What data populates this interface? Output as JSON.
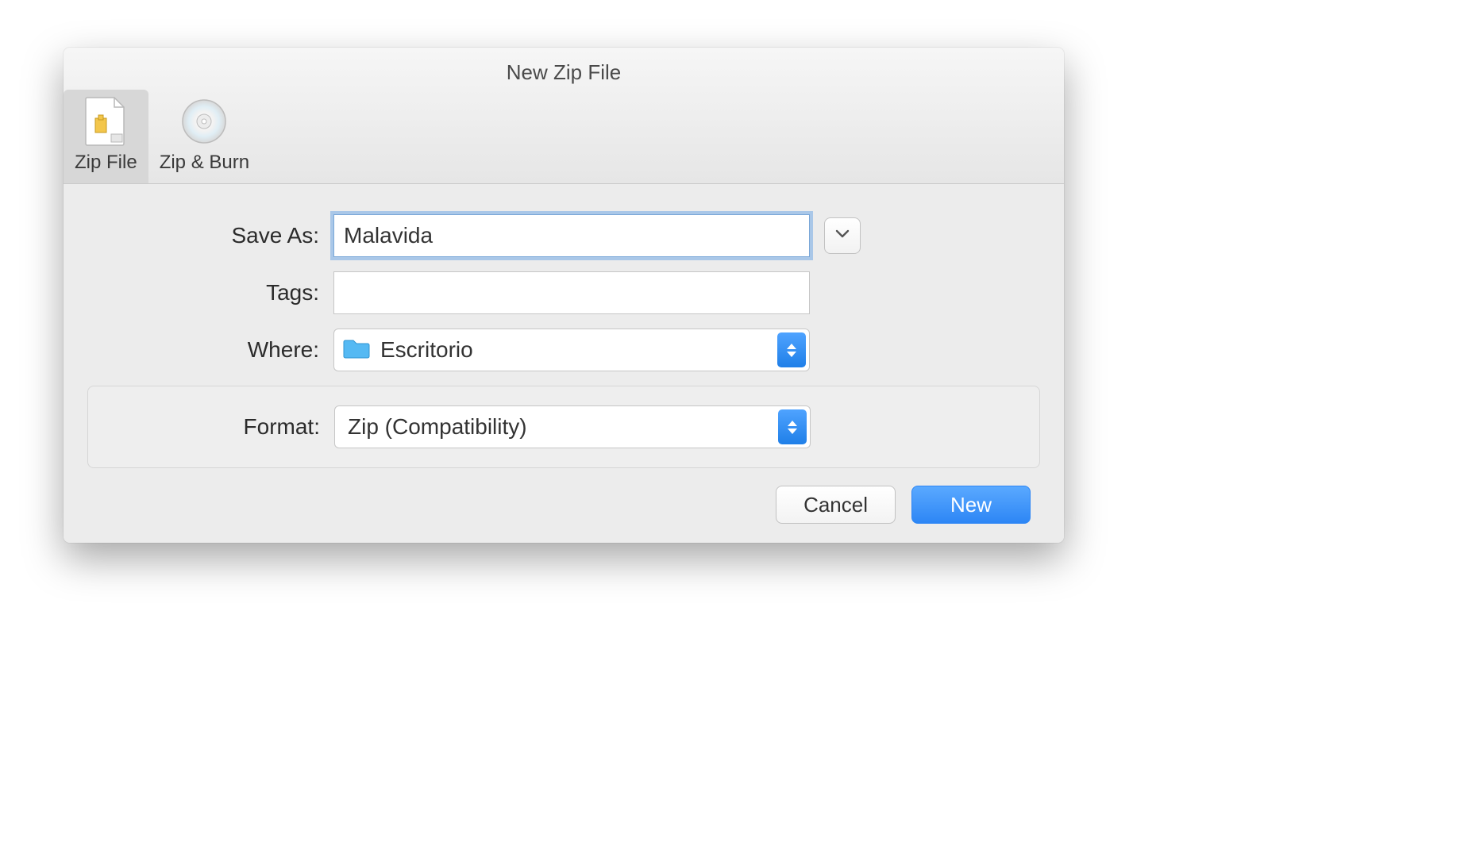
{
  "window": {
    "title": "New Zip File"
  },
  "tabs": {
    "zip_file": {
      "label": "Zip File"
    },
    "zip_burn": {
      "label": "Zip & Burn"
    }
  },
  "form": {
    "save_as_label": "Save As:",
    "save_as_value": "Malavida",
    "tags_label": "Tags:",
    "tags_value": "",
    "where_label": "Where:",
    "where_value": "Escritorio",
    "format_label": "Format:",
    "format_value": "Zip (Compatibility)"
  },
  "buttons": {
    "cancel": "Cancel",
    "new": "New"
  },
  "colors": {
    "accent": "#2d86f5",
    "window_bg": "#ececec"
  }
}
